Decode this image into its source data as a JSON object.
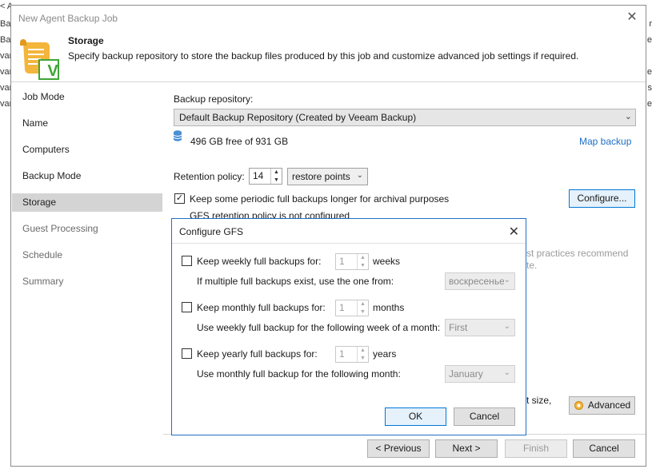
{
  "background": {
    "left_fragments": [
      "< A",
      "Ba",
      "Ba",
      "vare",
      "vare",
      "vare",
      "vare"
    ],
    "right_fragments": [
      "r",
      "e",
      "e",
      "s",
      "e"
    ]
  },
  "window": {
    "title": "New Agent Backup Job",
    "close_glyph": "✕"
  },
  "header": {
    "title": "Storage",
    "description": "Specify backup repository to store the backup files produced by this job and customize advanced job settings if required.",
    "logo_letter": "V"
  },
  "nav": {
    "items": [
      {
        "label": "Job Mode"
      },
      {
        "label": "Name"
      },
      {
        "label": "Computers"
      },
      {
        "label": "Backup Mode"
      },
      {
        "label": "Storage"
      },
      {
        "label": "Guest Processing"
      },
      {
        "label": "Schedule"
      },
      {
        "label": "Summary"
      }
    ],
    "active_index": 4
  },
  "storage": {
    "repo_label": "Backup repository:",
    "repo_value": "Default Backup Repository (Created by Veeam Backup)",
    "free_space": "496 GB free of 931 GB",
    "map_backup_link": "Map backup",
    "retention_label": "Retention policy:",
    "retention_value": "14",
    "retention_unit": "restore points",
    "gfs_checkbox_label": "Keep some periodic full backups longer for archival purposes",
    "gfs_checked": true,
    "gfs_status": "GFS retention policy is not configured",
    "configure_button": "Configure...",
    "hidden_text_1": "st practices recommend",
    "hidden_text_2": "te.",
    "hidden_text_3": "t size,",
    "advanced_button": "Advanced"
  },
  "footer": {
    "previous": "< Previous",
    "next": "Next >",
    "finish": "Finish",
    "cancel": "Cancel"
  },
  "dialog": {
    "title": "Configure GFS",
    "weekly_label": "Keep weekly full backups for:",
    "weekly_value": "1",
    "weekly_unit": "weeks",
    "weekly_sub_label": "If multiple full backups exist, use the one from:",
    "weekly_sub_value": "воскресенье",
    "monthly_label": "Keep monthly full backups for:",
    "monthly_value": "1",
    "monthly_unit": "months",
    "monthly_sub_label": "Use weekly full backup for the following week of a month:",
    "monthly_sub_value": "First",
    "yearly_label": "Keep yearly full backups for:",
    "yearly_value": "1",
    "yearly_unit": "years",
    "yearly_sub_label": "Use monthly full backup for the following month:",
    "yearly_sub_value": "January",
    "ok_button": "OK",
    "cancel_button": "Cancel"
  },
  "colors": {
    "accent": "#1f6fc5",
    "active_nav": "#d4d4d4",
    "logo_gold": "#f3b53b",
    "logo_green": "#3fa535"
  }
}
